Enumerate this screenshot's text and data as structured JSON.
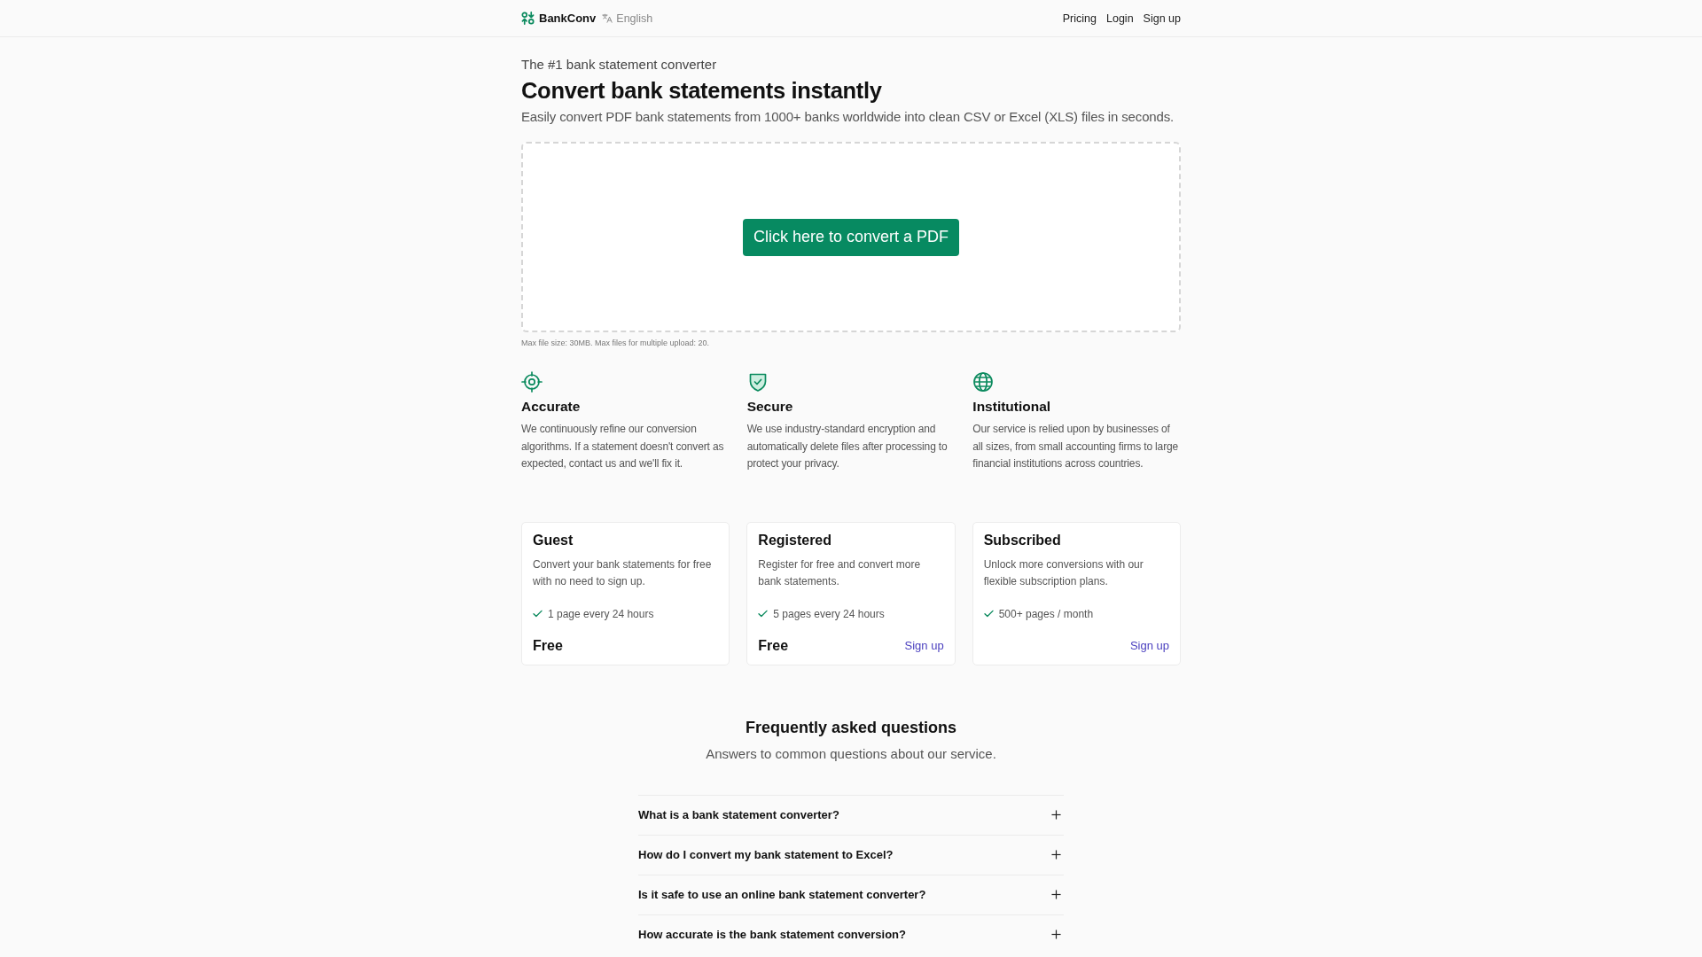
{
  "header": {
    "brand": "BankConv",
    "language": "English",
    "nav": [
      "Pricing",
      "Login",
      "Sign up"
    ]
  },
  "hero": {
    "eyebrow": "The #1 bank statement converter",
    "title": "Convert bank statements instantly",
    "subtitle": "Easily convert PDF bank statements from 1000+ banks worldwide into clean CSV or Excel (XLS) files in seconds."
  },
  "upload": {
    "button": "Click here to convert a PDF",
    "note": "Max file size: 30MB. Max files for multiple upload: 20."
  },
  "features": [
    {
      "title": "Accurate",
      "text": "We continuously refine our conversion algorithms. If a statement doesn't convert as expected, contact us and we'll fix it."
    },
    {
      "title": "Secure",
      "text": "We use industry-standard encryption and automatically delete files after processing to protect your privacy."
    },
    {
      "title": "Institutional",
      "text": "Our service is relied upon by businesses of all sizes, from small accounting firms to large financial institutions across countries."
    }
  ],
  "plans": [
    {
      "name": "Guest",
      "description": "Convert your bank statements for free with no need to sign up.",
      "feature": "1 page every 24 hours",
      "price": "Free"
    },
    {
      "name": "Registered",
      "description": "Register for free and convert more bank statements.",
      "feature": "5 pages every 24 hours",
      "price": "Free",
      "action": "Sign up"
    },
    {
      "name": "Subscribed",
      "description": "Unlock more conversions with our flexible subscription plans.",
      "feature": "500+ pages / month",
      "action": "Sign up"
    }
  ],
  "faq": {
    "title": "Frequently asked questions",
    "subtitle": "Answers to common questions about our service.",
    "items": [
      {
        "question": "What is a bank statement converter?",
        "expanded": false
      },
      {
        "question": "How do I convert my bank statement to Excel?",
        "expanded": false
      },
      {
        "question": "Is it safe to use an online bank statement converter?",
        "expanded": false
      },
      {
        "question": "How accurate is the bank statement conversion?",
        "expanded": false
      }
    ]
  }
}
